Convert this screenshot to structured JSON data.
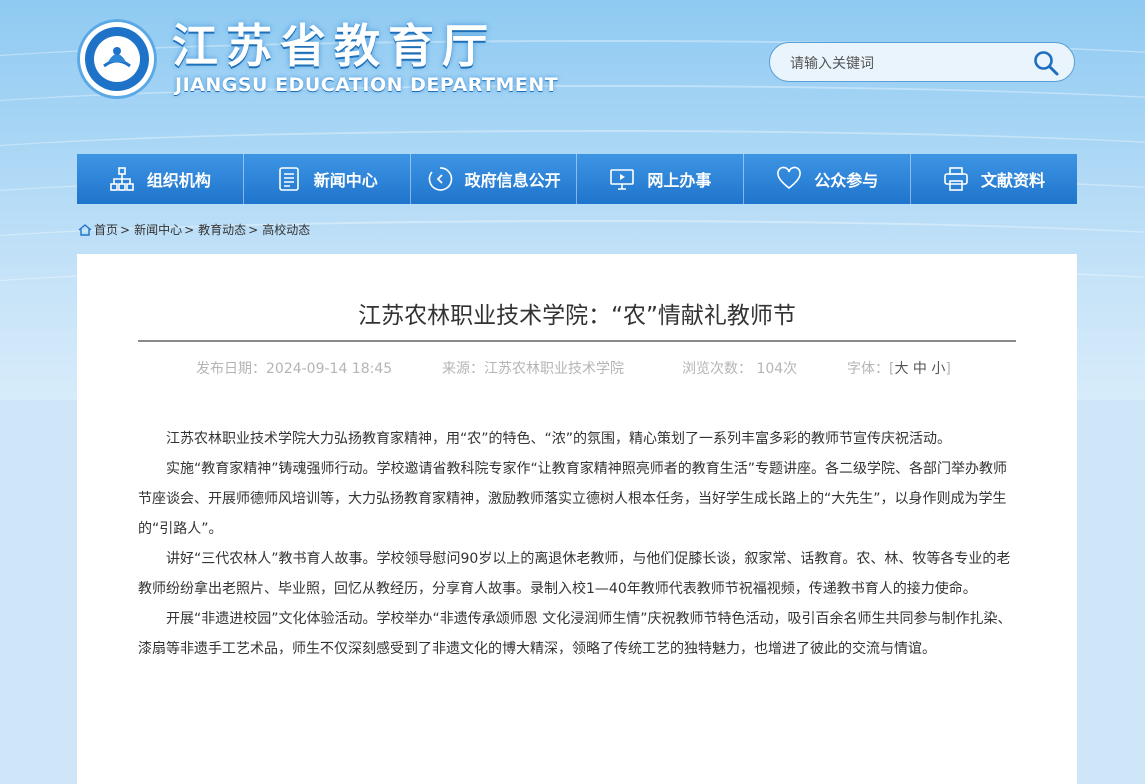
{
  "header": {
    "site_title": "江苏省教育厅",
    "site_subtitle": "JIANGSU EDUCATION DEPARTMENT",
    "search_placeholder": "请输入关键词",
    "search_icon": "search-icon"
  },
  "nav": {
    "items": [
      {
        "label": "组织机构",
        "icon": "org-chart-icon"
      },
      {
        "label": "新闻中心",
        "icon": "document-icon"
      },
      {
        "label": "政府信息公开",
        "icon": "circle-arrow-icon"
      },
      {
        "label": "网上办事",
        "icon": "monitor-icon"
      },
      {
        "label": "公众参与",
        "icon": "heart-icon"
      },
      {
        "label": "文献资料",
        "icon": "printer-icon"
      }
    ]
  },
  "breadcrumb": {
    "home_icon": "home-icon",
    "items": [
      "首页",
      "新闻中心",
      "教育动态",
      "高校动态"
    ],
    "separator": ">"
  },
  "article": {
    "title": "江苏农林职业技术学院：“农”情献礼教师节",
    "publish_date": "发布日期：2024-09-14 18:45",
    "source": "来源：江苏农林职业技术学院",
    "views": "浏览次数：  104次",
    "font_label": "字体：[",
    "font_large": "大",
    "font_medium": "中",
    "font_small": "小",
    "font_close": "]",
    "paragraphs": [
      "江苏农林职业技术学院大力弘扬教育家精神，用“农”的特色、“浓”的氛围，精心策划了一系列丰富多彩的教师节宣传庆祝活动。",
      "实施“教育家精神”铸魂强师行动。学校邀请省教科院专家作“让教育家精神照亮师者的教育生活”专题讲座。各二级学院、各部门举办教师节座谈会、开展师德师风培训等，大力弘扬教育家精神，激励教师落实立德树人根本任务，当好学生成长路上的“大先生”，以身作则成为学生的“引路人”。",
      "讲好“三代农林人”教书育人故事。学校领导慰问90岁以上的离退休老教师，与他们促膝长谈，叙家常、话教育。农、林、牧等各专业的老教师纷纷拿出老照片、毕业照，回忆从教经历，分享育人故事。录制入校1—40年教师代表教师节祝福视频，传递教书育人的接力使命。",
      "开展“非遗进校园”文化体验活动。学校举办“非遗传承颂师恩 文化浸润师生情”庆祝教师节特色活动，吸引百余名师生共同参与制作扎染、漆扇等非遗手工艺术品，师生不仅深刻感受到了非遗文化的博大精深，领略了传统工艺的独特魅力，也增进了彼此的交流与情谊。"
    ]
  },
  "colors": {
    "nav_top": "#3e95e4",
    "nav_bottom": "#1f74cc",
    "text": "#333333",
    "meta": "#b5b5b5"
  }
}
